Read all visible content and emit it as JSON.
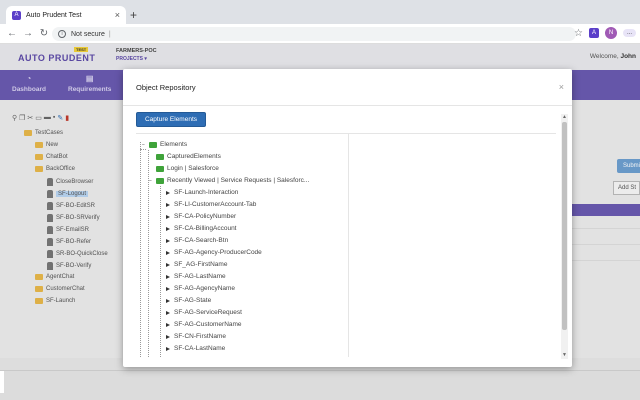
{
  "browser": {
    "tab_title": "Auto Prudent Test",
    "tab_icon": "auto-prudent-favicon",
    "new_tab": "+",
    "address": "Not secure",
    "address_sep": "|",
    "ext_letter": "A",
    "avatar_letter": "N",
    "profile_label": "..."
  },
  "app": {
    "logo": "AUTO PRUDENT",
    "badge": "TEST",
    "project_name": "FARMERS-POC",
    "project_link": "PROJECTS ▾",
    "welcome": "Welcome,",
    "user": "John",
    "accent": "#6a5ab0"
  },
  "nav": [
    {
      "label": "Dashboard",
      "icon": "gauge-icon"
    },
    {
      "label": "Requirements",
      "icon": "list-icon"
    }
  ],
  "left_tree": [
    {
      "label": "TestCases",
      "kind": "folder"
    },
    {
      "label": "New",
      "kind": "folder"
    },
    {
      "label": "ChatBot",
      "kind": "folder"
    },
    {
      "label": "BackOffice",
      "kind": "folder"
    },
    {
      "label": "CloseBrowser",
      "kind": "file"
    },
    {
      "label": "SF-Logout",
      "kind": "file",
      "selected": true
    },
    {
      "label": "SF-BO-EditSR",
      "kind": "file"
    },
    {
      "label": "SF-BO-SRVerify",
      "kind": "file"
    },
    {
      "label": "SF-EmailSR",
      "kind": "file"
    },
    {
      "label": "SF-BO-Refer",
      "kind": "file"
    },
    {
      "label": "SR-BO-QuickClose",
      "kind": "file"
    },
    {
      "label": "SF-BO-Verify",
      "kind": "file"
    },
    {
      "label": "AgentChat",
      "kind": "folder"
    },
    {
      "label": "CustomerChat",
      "kind": "folder"
    },
    {
      "label": "SF-Launch",
      "kind": "folder"
    }
  ],
  "right": {
    "submit": "Submi",
    "add": "Add St"
  },
  "modal": {
    "title": "Object Repository",
    "close": "×",
    "capture_button": "Capture Elements",
    "tree": {
      "root": "Elements",
      "folders": [
        "CapturedElements",
        "Login | Salesforce",
        "Recently Viewed | Service Requests | Salesforc..."
      ],
      "items": [
        "SF-Launch-Interaction",
        "SF-LI-CustomerAccount-Tab",
        "SF-CA-PolicyNumber",
        "SF-CA-BillingAccount",
        "SF-CA-Search-Btn",
        "SF-AG-Agency-ProducerCode",
        "SF_AG-FirstName",
        "SF-AG-LastName",
        "SF-AG-AgencyName",
        "SF-AG-State",
        "SF-AG-ServiceRequest",
        "SF-AG-CustomerName",
        "SF-CN-FirstName",
        "SF-CA-LastName"
      ]
    }
  }
}
